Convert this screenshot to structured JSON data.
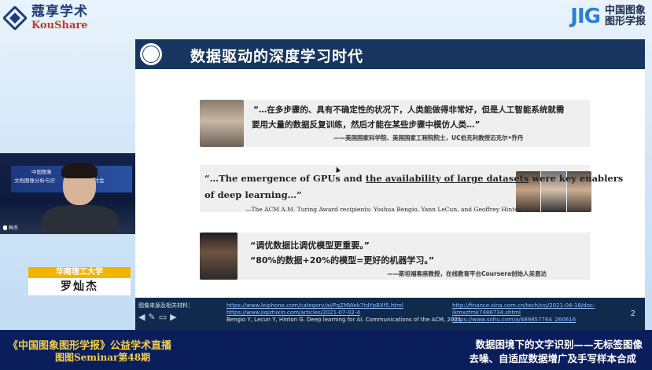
{
  "logo_left": {
    "cn": "蔻享学术",
    "en": "KouShare"
  },
  "logo_right": {
    "mark": "JIG",
    "line1": "中国图象",
    "line2": "图形学报"
  },
  "slide": {
    "title": "数据驱动的深度学习时代",
    "quote1": {
      "line1": "“…在多步骤的、具有不确定性的状况下，人类能做得非常好，但是人工智能系统就需",
      "line2": "要用大量的数据反复训练，然后才能在某些步骤中模仿人类…”",
      "attribution": "——美国国家科学院、美国国家工程院院士，UC伯克利教授迈克尔•乔丹"
    },
    "quote2": {
      "line1_pre": "“…The emergence of GPUs and ",
      "line1_ul": "the availability of large datasets",
      "line1_post": " were key enablers",
      "line2": "of deep learning…”",
      "attribution": "—The ACM A.M. Turing Award recipients: Yoshua Bengio, Yann LeCun, and Geoffrey Hinton"
    },
    "quote3": {
      "line1": "“调优数据比调优模型更重要。”",
      "line2": "“80%的数据+20%的模型=更好的机器学习。”",
      "attribution": "——斯坦福客座教授，在线教育平台Coursera创始人吴恩达"
    },
    "footer": {
      "label": "图像来源及相关材料：",
      "link1": "https://www.leiphone.com/category/ai/PgZMWek7tdYpBXf5.html",
      "link2": "https://www.jiqizhixin.com/articles/2021-07-02-4",
      "text3": "Bengio Y, Lecun Y, Hinton G. Deep learning for AI. Communications of the ACM, 2021.",
      "link4": "http://finance.sina.com.cn/tech/csj/2021-04-18/doc-",
      "link5": "ikmxzfmk7486734.shtml",
      "link6": "https://www.sohu.com/a/489857764_260616",
      "page": "2"
    }
  },
  "video": {
    "banner_line1": "中国图象",
    "banner_line2": "文档图像分析与识",
    "banner_line3": "学术研讨会",
    "speaker_tag": "桓杰"
  },
  "speaker": {
    "affiliation": "华南理工大学",
    "name": "罗灿杰"
  },
  "bottom": {
    "left_line1": "《中国图象图形学报》公益学术直播",
    "left_line2": "图图Seminar第48期",
    "right_line1": "数据困境下的文字识别——无标签图像",
    "right_line2": "去噪、自适应数据增广及手写样本合成"
  },
  "colors": {
    "slide_header": "#17365f",
    "footer_bg": "#102a4d",
    "bottom_bar": "#0b1e5c",
    "accent_yellow": "#f3b400",
    "quote_box": "#efefef"
  }
}
